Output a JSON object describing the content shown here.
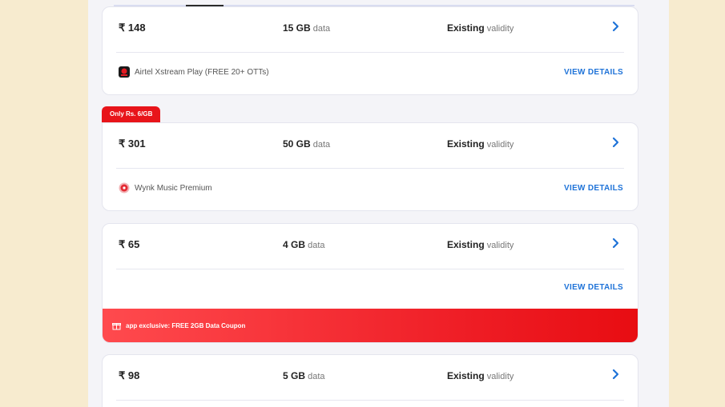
{
  "currency": "₹",
  "plans": [
    {
      "price": "₹ 148",
      "data_amount": "15 GB",
      "data_suffix": "data",
      "validity_value": "Existing",
      "validity_suffix": "validity",
      "benefit": "Airtel Xstream Play (FREE 20+ OTTs)",
      "benefit_icon": "xstream-play-icon",
      "details_label": "VIEW DETAILS"
    },
    {
      "tag": "Only Rs. 6/GB",
      "price": "₹ 301",
      "data_amount": "50 GB",
      "data_suffix": "data",
      "validity_value": "Existing",
      "validity_suffix": "validity",
      "benefit": "Wynk Music Premium",
      "benefit_icon": "wynk-music-icon",
      "details_label": "VIEW DETAILS"
    },
    {
      "price": "₹ 65",
      "data_amount": "4 GB",
      "data_suffix": "data",
      "validity_value": "Existing",
      "validity_suffix": "validity",
      "details_label": "VIEW DETAILS",
      "banner": "app exclusive: FREE 2GB Data Coupon"
    },
    {
      "price": "₹ 98",
      "data_amount": "5 GB",
      "data_suffix": "data",
      "validity_value": "Existing",
      "validity_suffix": "validity"
    }
  ],
  "colors": {
    "accent_blue": "#1f73d8",
    "promo_red": "#e8141a",
    "page_bg": "#f7ebcf"
  }
}
